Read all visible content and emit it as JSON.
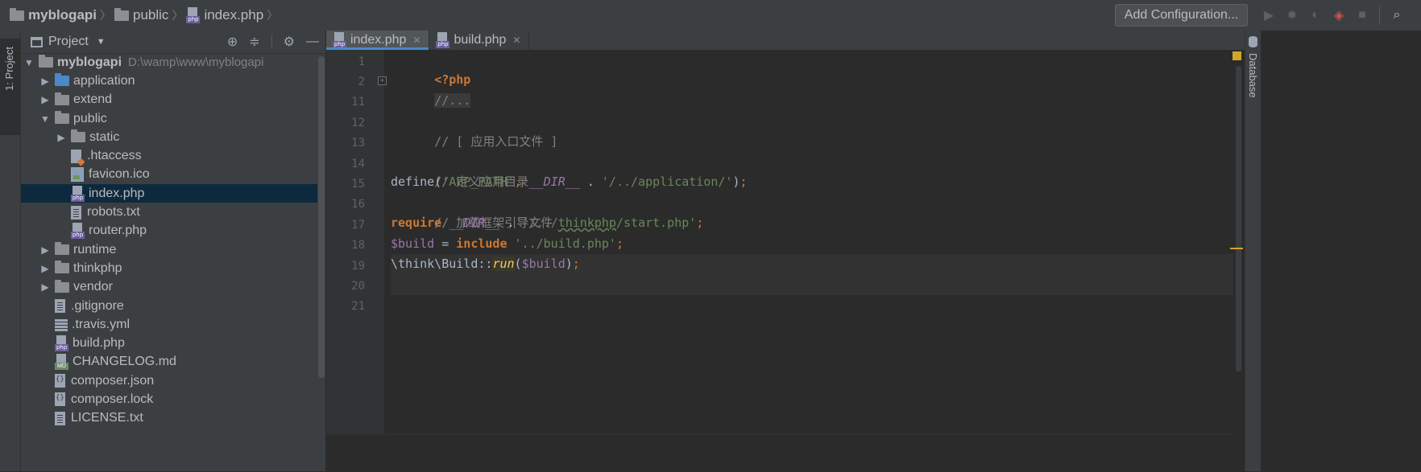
{
  "breadcrumb": {
    "project": "myblogapi",
    "folder": "public",
    "file": "index.php",
    "sep": "〉"
  },
  "toolbar": {
    "add_config_label": "Add Configuration..."
  },
  "left_strip": {
    "tab_label": "1: Project"
  },
  "right_strip": {
    "tab_label": "Database"
  },
  "project_panel": {
    "title": "Project",
    "root_name": "myblogapi",
    "root_path": "D:\\wamp\\www\\myblogapi",
    "items": [
      {
        "label": "application"
      },
      {
        "label": "extend"
      },
      {
        "label": "public"
      },
      {
        "label": "static"
      },
      {
        "label": ".htaccess"
      },
      {
        "label": "favicon.ico"
      },
      {
        "label": "index.php"
      },
      {
        "label": "robots.txt"
      },
      {
        "label": "router.php"
      },
      {
        "label": "runtime"
      },
      {
        "label": "thinkphp"
      },
      {
        "label": "vendor"
      },
      {
        "label": ".gitignore"
      },
      {
        "label": ".travis.yml"
      },
      {
        "label": "build.php"
      },
      {
        "label": "CHANGELOG.md"
      },
      {
        "label": "composer.json"
      },
      {
        "label": "composer.lock"
      },
      {
        "label": "LICENSE.txt"
      }
    ]
  },
  "editor": {
    "tabs": [
      {
        "label": "index.php"
      },
      {
        "label": "build.php"
      }
    ],
    "line_numbers": [
      "1",
      "2",
      "11",
      "12",
      "13",
      "14",
      "15",
      "16",
      "17",
      "18",
      "19",
      "20",
      "21"
    ],
    "code": {
      "l1": "<?php",
      "l2": "//...",
      "l12": "// [ 应用入口文件 ]",
      "l14": "// 定义应用目录",
      "l15_a": "define(",
      "l15_b": "'APP_PATH'",
      "l15_c": ", ",
      "l15_d": "__DIR__",
      "l15_e": " . ",
      "l15_f": "'/../application/'",
      "l15_g": ")",
      "l15_h": ";",
      "l16": "// 加载框架引导文件",
      "l17_a": "require",
      "l17_b": " ",
      "l17_c": "__DIR__",
      "l17_d": " . ",
      "l17_e": "'/../",
      "l17_f": "thinkphp",
      "l17_g": "/start.php'",
      "l17_h": ";",
      "l18_a": "$build",
      "l18_b": " = ",
      "l18_c": "include",
      "l18_d": " ",
      "l18_e": "'../build.php'",
      "l18_f": ";",
      "l19_a": "\\think\\Build::",
      "l19_b": "run",
      "l19_c": "(",
      "l19_d": "$build",
      "l19_e": ")",
      "l19_f": ";"
    }
  }
}
